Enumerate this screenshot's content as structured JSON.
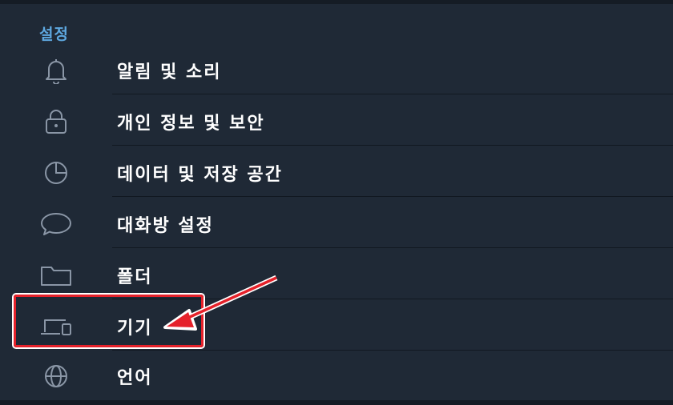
{
  "settings": {
    "title": "설정",
    "items": [
      {
        "label": "알림 및 소리",
        "icon": "bell-icon"
      },
      {
        "label": "개인 정보 및 보안",
        "icon": "lock-icon"
      },
      {
        "label": "데이터 및 저장 공간",
        "icon": "pie-chart-icon"
      },
      {
        "label": "대화방 설정",
        "icon": "chat-bubble-icon"
      },
      {
        "label": "폴더",
        "icon": "folder-icon"
      },
      {
        "label": "기기",
        "icon": "devices-icon"
      },
      {
        "label": "언어",
        "icon": "globe-icon"
      }
    ]
  },
  "colors": {
    "background": "#1f2936",
    "accent": "#5ea8e0",
    "annotation": "#e5212a"
  }
}
